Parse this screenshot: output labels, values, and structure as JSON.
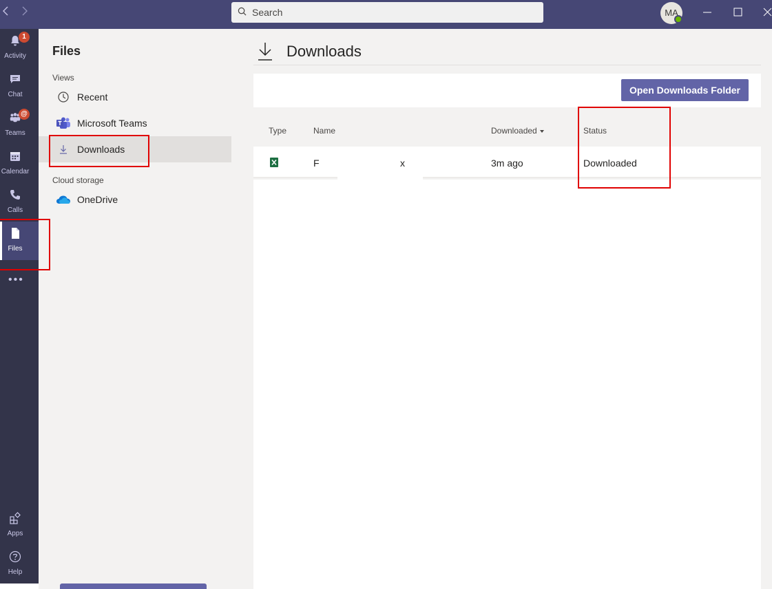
{
  "titlebar": {
    "search_placeholder": "Search",
    "avatar_initials": "MA",
    "back_icon": "chevron-left-icon",
    "forward_icon": "chevron-right-icon"
  },
  "rail": {
    "items": [
      {
        "label": "Activity",
        "icon": "bell-icon",
        "badge": "1"
      },
      {
        "label": "Chat",
        "icon": "chat-icon"
      },
      {
        "label": "Teams",
        "icon": "teams-icon",
        "badge": "@"
      },
      {
        "label": "Calendar",
        "icon": "calendar-icon"
      },
      {
        "label": "Calls",
        "icon": "phone-icon"
      },
      {
        "label": "Files",
        "icon": "file-icon",
        "active": true
      },
      {
        "label": "Apps",
        "icon": "apps-icon"
      },
      {
        "label": "Help",
        "icon": "help-icon"
      }
    ],
    "more": "•••"
  },
  "files_pane": {
    "title": "Files",
    "views_label": "Views",
    "views": [
      {
        "label": "Recent",
        "icon": "clock-icon"
      },
      {
        "label": "Microsoft Teams",
        "icon": "teams-logo-icon"
      },
      {
        "label": "Downloads",
        "icon": "download-icon",
        "selected": true
      }
    ],
    "cloud_label": "Cloud storage",
    "cloud": [
      {
        "label": "OneDrive",
        "icon": "onedrive-icon"
      }
    ]
  },
  "main": {
    "title": "Downloads",
    "open_folder_button": "Open Downloads Folder",
    "columns": {
      "type": "Type",
      "name": "Name",
      "downloaded": "Downloaded",
      "status": "Status"
    },
    "rows": [
      {
        "type_icon": "excel-icon",
        "name_start": "F",
        "name_end": "x",
        "downloaded": "3m ago",
        "status": "Downloaded"
      }
    ]
  },
  "colors": {
    "titlebar": "#464775",
    "rail": "#33344a",
    "accent": "#6264a7",
    "highlight": "#e00000"
  }
}
